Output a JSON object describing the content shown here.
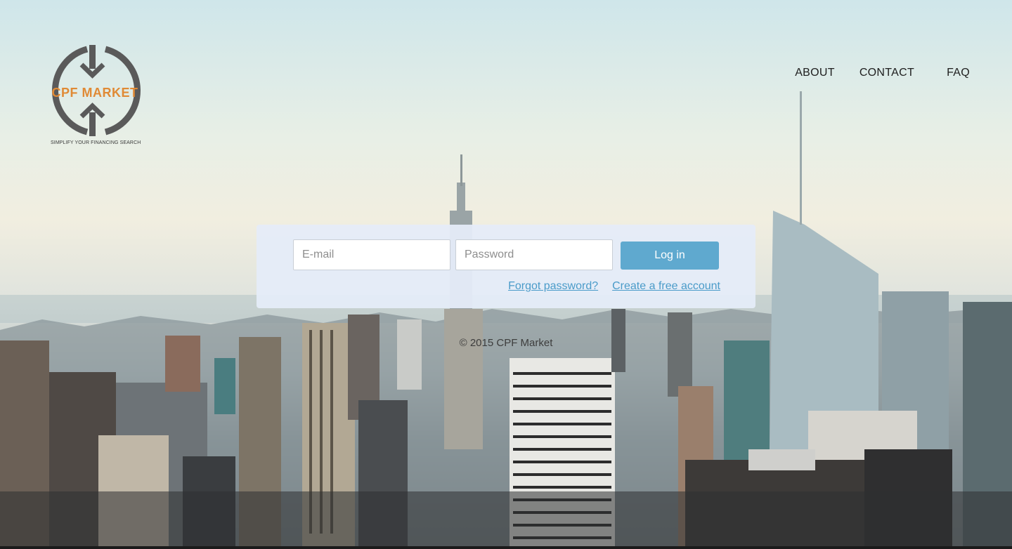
{
  "brand": {
    "name": "CPF MARKET",
    "tagline": "SIMPLIFY YOUR FINANCING SEARCH",
    "logo_ring_color": "#5a5a5a",
    "logo_text_color": "#e08a35"
  },
  "nav": {
    "items": [
      {
        "label": "ABOUT"
      },
      {
        "label": "CONTACT"
      },
      {
        "label": "FAQ"
      }
    ]
  },
  "login": {
    "email_placeholder": "E-mail",
    "email_value": "",
    "password_placeholder": "Password",
    "password_value": "",
    "button_label": "Log in",
    "forgot_label": "Forgot password?",
    "create_label": "Create a free account",
    "accent_color": "#5fa9cf",
    "link_color": "#4a9bc9"
  },
  "footer": {
    "copyright": "© 2015 CPF Market"
  }
}
